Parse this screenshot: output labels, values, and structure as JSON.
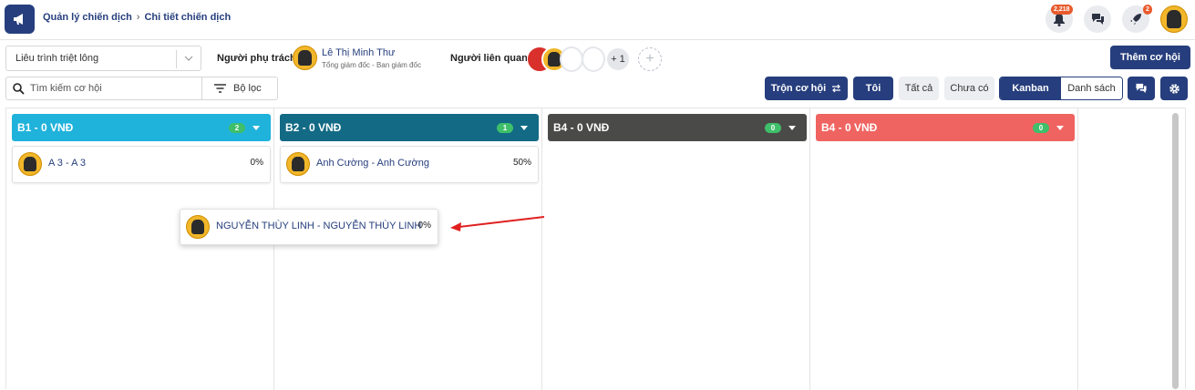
{
  "breadcrumb": {
    "root": "Quản lý chiến dịch",
    "separator": "›",
    "current": "Chi tiết chiến dịch"
  },
  "topbar": {
    "notification_count": "2,218",
    "rocket_count": "2"
  },
  "pipeline_select": {
    "value": "Liêu trình triệt lông"
  },
  "owner": {
    "label": "Người phụ trách",
    "name": "Lê Thị Minh Thư",
    "role": "Tổng giám đốc - Ban giám đốc"
  },
  "related": {
    "label": "Người liên quan",
    "more": "+ 1",
    "add": "+"
  },
  "add_opportunity": "Thêm cơ hội",
  "search": {
    "placeholder": "Tìm kiếm cơ hội"
  },
  "filter_label": "Bộ lọc",
  "merge_label": "Trộn cơ hội",
  "me_label": "Tôi",
  "all_label": "Tất cả",
  "none_label": "Chưa có",
  "view": {
    "kanban": "Kanban",
    "list": "Danh sách"
  },
  "columns": [
    {
      "title": "B1 - 0 VNĐ",
      "count": "2",
      "color": "#1fb2db"
    },
    {
      "title": "B2 - 0 VNĐ",
      "count": "1",
      "color": "#136a85"
    },
    {
      "title": "B4 - 0 VNĐ",
      "count": "0",
      "color": "#4a4a48"
    },
    {
      "title": "B4 - 0 VNĐ",
      "count": "0",
      "color": "#ef6461"
    }
  ],
  "cards": [
    {
      "name": "A 3 - A 3",
      "percent": "0%"
    },
    {
      "name": "Anh Cường - Anh Cường",
      "percent": "50%"
    },
    {
      "name": "NGUYỄN THÙY LINH - NGUYỄN THÙY LINH",
      "percent": "0%"
    }
  ],
  "icons": [
    "megaphone-icon",
    "bell-icon",
    "chat-icon",
    "rocket-icon",
    "search-icon",
    "filter-icon",
    "swap-icon",
    "settings-icon",
    "chevron-down-icon"
  ],
  "accent": "#263e7d",
  "arrow_color": "#e02020"
}
